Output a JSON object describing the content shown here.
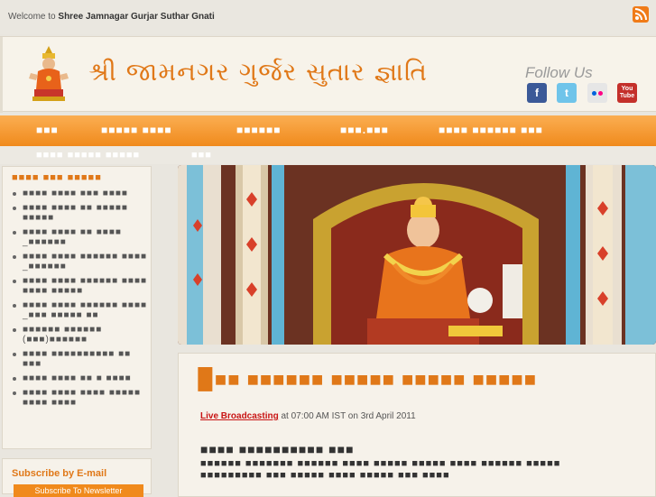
{
  "topbar": {
    "welcome_prefix": "Welcome to",
    "welcome_site": "Shree Jamnagar Gurjar Suthar Gnati",
    "rss_icon": "rss-icon"
  },
  "header": {
    "site_title": "શ્રી જામનગર ગુર્જર સુતાર જ્ઞાતિ",
    "follow_label": "Follow Us",
    "social": [
      {
        "name": "facebook-icon",
        "glyph": "f"
      },
      {
        "name": "twitter-icon",
        "glyph": "t"
      },
      {
        "name": "flickr-icon",
        "glyph": ""
      },
      {
        "name": "youtube-icon",
        "glyph_top": "You",
        "glyph_bottom": "Tube"
      }
    ]
  },
  "nav": {
    "items": [
      "■■■",
      "■■■■■ ■■■■",
      "■■■■■■",
      "■■■.■■■",
      "■■■■ ■■■■■■ ■■■"
    ],
    "sub_items": [
      "■■■■ ■■■■■ ■■■■■",
      "■■■"
    ]
  },
  "sidebar": {
    "title": "■■■■ ■■■ ■■■■■",
    "items": [
      "■■■■ ■■■■ ■■■ ■■■■",
      "■■■■ ■■■■ ■■ ■■■■■ ■■■■■",
      "■■■■ ■■■■ ■■ ■■■■ _■■■■■■",
      "■■■■ ■■■■ ■■■■■■ ■■■■ _■■■■■■",
      "■■■■ ■■■■ ■■■■■■ ■■■■ ■■■■ ■■■■■",
      "■■■■ ■■■■ ■■■■■■ ■■■■ _■■■ ■■■■■ ■■",
      "■■■■■■ ■■■■■■ (■■■)■■■■■■",
      "■■■■ ■■■■■■■■■■ ■■ ■■■",
      "■■■■ ■■■■ ■■ ■ ■■■■",
      "■■■■ ■■■■ ■■■■ ■■■■■ ■■■■ ■■■■"
    ]
  },
  "subscribe": {
    "title": "Subscribe by E-mail",
    "button_label": "Subscribe To Newsletter"
  },
  "post": {
    "title": "▉■■ ■■■■■■ ■■■■■ ■■■■■ ■■■■■",
    "meta_link": "Live Broadcasting",
    "meta_text": "at 07:00 AM IST on 3rd April 2011",
    "heading": "■■■■ ■■■■■■■■■■ ■■■",
    "body": "■■■■■■ ■■■■■■■ ■■■■■■ ■■■■ ■■■■■ ■■■■■ ■■■■ ■■■■■■ ■■■■■ ■■■■■■■■■ ■■■ ■■■■■ ■■■■ ■■■■■ ■■■ ■■■■"
  },
  "colors": {
    "accent": "#f08a1c",
    "title_orange": "#e07818",
    "link_red": "#c81414"
  }
}
